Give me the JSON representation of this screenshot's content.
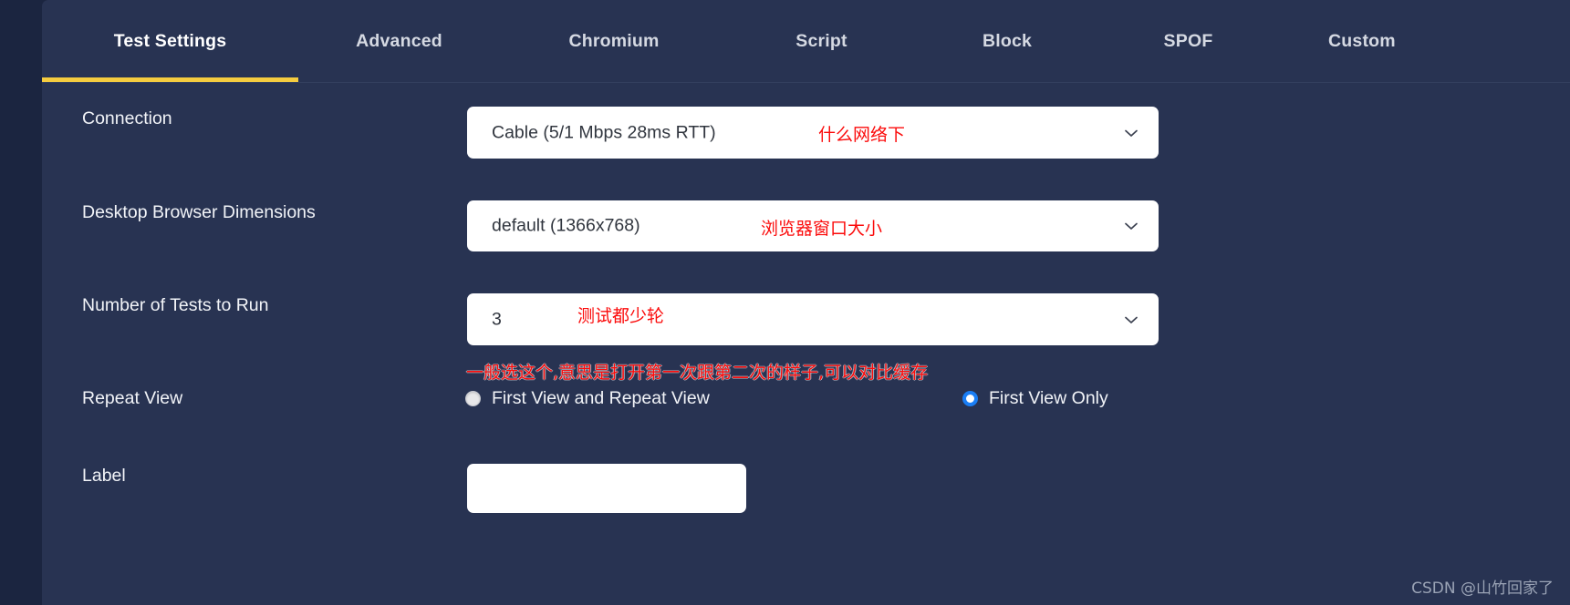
{
  "theme": {
    "page_background": "#1b2540",
    "panel_background": "#283352",
    "active_tab_underline": "#f5cc3f",
    "annotation_color": "#fb0b0b",
    "radio_selected_color": "#1a7ef5",
    "label_text_color": "#f2f4f8",
    "field_background": "#ffffff"
  },
  "tabs": [
    {
      "label": "Test Settings",
      "active": true
    },
    {
      "label": "Advanced",
      "active": false
    },
    {
      "label": "Chromium",
      "active": false
    },
    {
      "label": "Script",
      "active": false
    },
    {
      "label": "Block",
      "active": false
    },
    {
      "label": "SPOF",
      "active": false
    },
    {
      "label": "Custom",
      "active": false
    }
  ],
  "form": {
    "connection": {
      "label": "Connection",
      "value": "Cable (5/1 Mbps 28ms RTT)",
      "annotation": "什么网络下",
      "chevron_icon": "chevron-down-icon"
    },
    "dimensions": {
      "label": "Desktop Browser Dimensions",
      "value": "default (1366x768)",
      "annotation": "浏览器窗口大小",
      "chevron_icon": "chevron-down-icon"
    },
    "number_of_tests": {
      "label": "Number of Tests to Run",
      "value": "3",
      "annotation": "测试都少轮",
      "chevron_icon": "chevron-down-icon"
    },
    "repeat_view": {
      "label": "Repeat View",
      "annotation": "一般选这个,意思是打开第一次跟第二次的样子,可以对比缓存",
      "options": [
        {
          "label": "First View and Repeat View",
          "selected": false
        },
        {
          "label": "First View Only",
          "selected": true
        }
      ]
    },
    "test_label": {
      "label": "Label",
      "value": "",
      "placeholder": ""
    }
  },
  "watermark": "CSDN @山竹回家了"
}
